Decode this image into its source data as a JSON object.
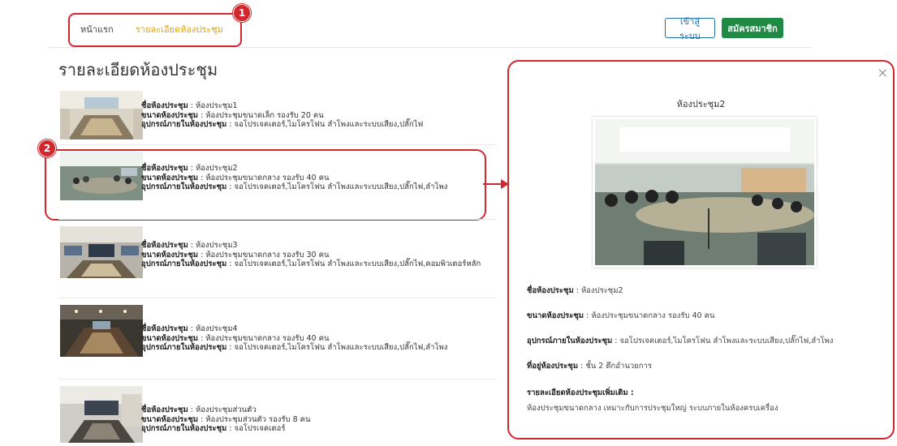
{
  "nav": {
    "home": "หน้าแรก",
    "detail": "รายละเอียดห้องประชุม",
    "login": "เข้าสู่ระบบ",
    "register": "สมัครสมาชิก"
  },
  "annotations": {
    "one": "1",
    "two": "2"
  },
  "page_title": "รายละเอียดห้องประชุม",
  "labels": {
    "name": "ชื่อห้องประชุม",
    "size": "ขนาดห้องประชุม",
    "equipment": "อุปกรณ์ภายในห้องประชุม",
    "location": "ที่อยู่ห้องประชุม",
    "more": "รายละเอียดห้องประชุมเพิ่มเติม :"
  },
  "rooms": [
    {
      "name": "ห้องประชุม1",
      "size": "ห้องประชุมขนาดเล็ก รองรับ 20 คน",
      "equipment": "จอโปรเจคเตอร์,ไมโครโฟน ลำโพงและระบบเสียง,ปลั๊กไฟ"
    },
    {
      "name": "ห้องประชุม2",
      "size": "ห้องประชุมขนาดกลาง รองรับ 40 คน",
      "equipment": "จอโปรเจคเตอร์,ไมโครโฟน ลำโพงและระบบเสียง,ปลั๊กไฟ,ลำโพง"
    },
    {
      "name": "ห้องประชุม3",
      "size": "ห้องประชุมขนาดกลาง รองรับ 30 คน",
      "equipment": "จอโปรเจคเตอร์,ไมโครโฟน ลำโพงและระบบเสียง,ปลั๊กไฟ,คอมพิวเตอร์หลัก"
    },
    {
      "name": "ห้องประชุม4",
      "size": "ห้องประชุมขนาดกลาง รองรับ 40 คน",
      "equipment": "จอโปรเจคเตอร์,ไมโครโฟน ลำโพงและระบบเสียง,ปลั๊กไฟ,ลำโพง"
    },
    {
      "name": "ห้องประชุมส่วนตัว",
      "size": "ห้องประชุมส่วนตัว รองรับ 8 คน",
      "equipment": "จอโปรเจคเตอร์"
    }
  ],
  "modal": {
    "title": "ห้องประชุม2",
    "name": "ห้องประชุม2",
    "size": "ห้องประชุมขนาดกลาง รองรับ 40 คน",
    "equipment": "จอโปรเจคเตอร์,ไมโครโฟน ลำโพงและระบบเสียง,ปลั๊กไฟ,ลำโพง",
    "location": "ชั้น 2 ตึกอำนวยการ",
    "more_text": "ห้องประชุมขนาดกลาง เหมาะกับการประชุมใหญ่ ระบบภายในห้องครบเครื่อง",
    "close": "×"
  },
  "colors": {
    "annotation": "#d0282d",
    "accent": "#d9a21b",
    "primary": "#1e6fa8",
    "success": "#1e8a44"
  },
  "icons": {
    "close": "close-icon",
    "arrow": "arrow-right-icon"
  }
}
